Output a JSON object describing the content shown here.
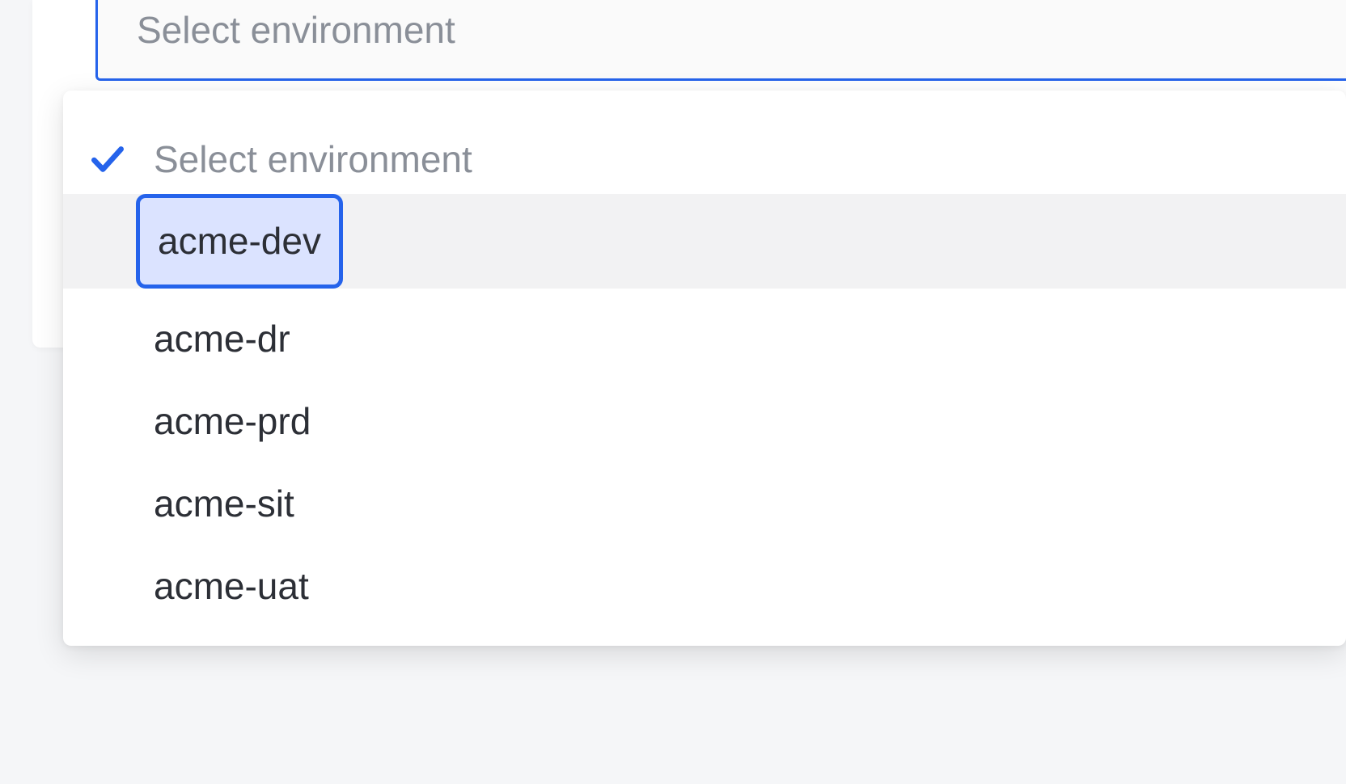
{
  "colors": {
    "focus_border": "#2563eb",
    "focus_fill": "#dbe3ff",
    "muted_text": "#8a8f98",
    "text": "#2c2f36",
    "hover_bg": "#f2f2f3"
  },
  "environment_select": {
    "placeholder": "Select environment",
    "dropdown_header": "Select environment",
    "header_checked": true,
    "options": [
      {
        "label": "acme-dev",
        "focused": true,
        "hovered": true
      },
      {
        "label": "acme-dr",
        "focused": false,
        "hovered": false
      },
      {
        "label": "acme-prd",
        "focused": false,
        "hovered": false
      },
      {
        "label": "acme-sit",
        "focused": false,
        "hovered": false
      },
      {
        "label": "acme-uat",
        "focused": false,
        "hovered": false
      }
    ]
  }
}
